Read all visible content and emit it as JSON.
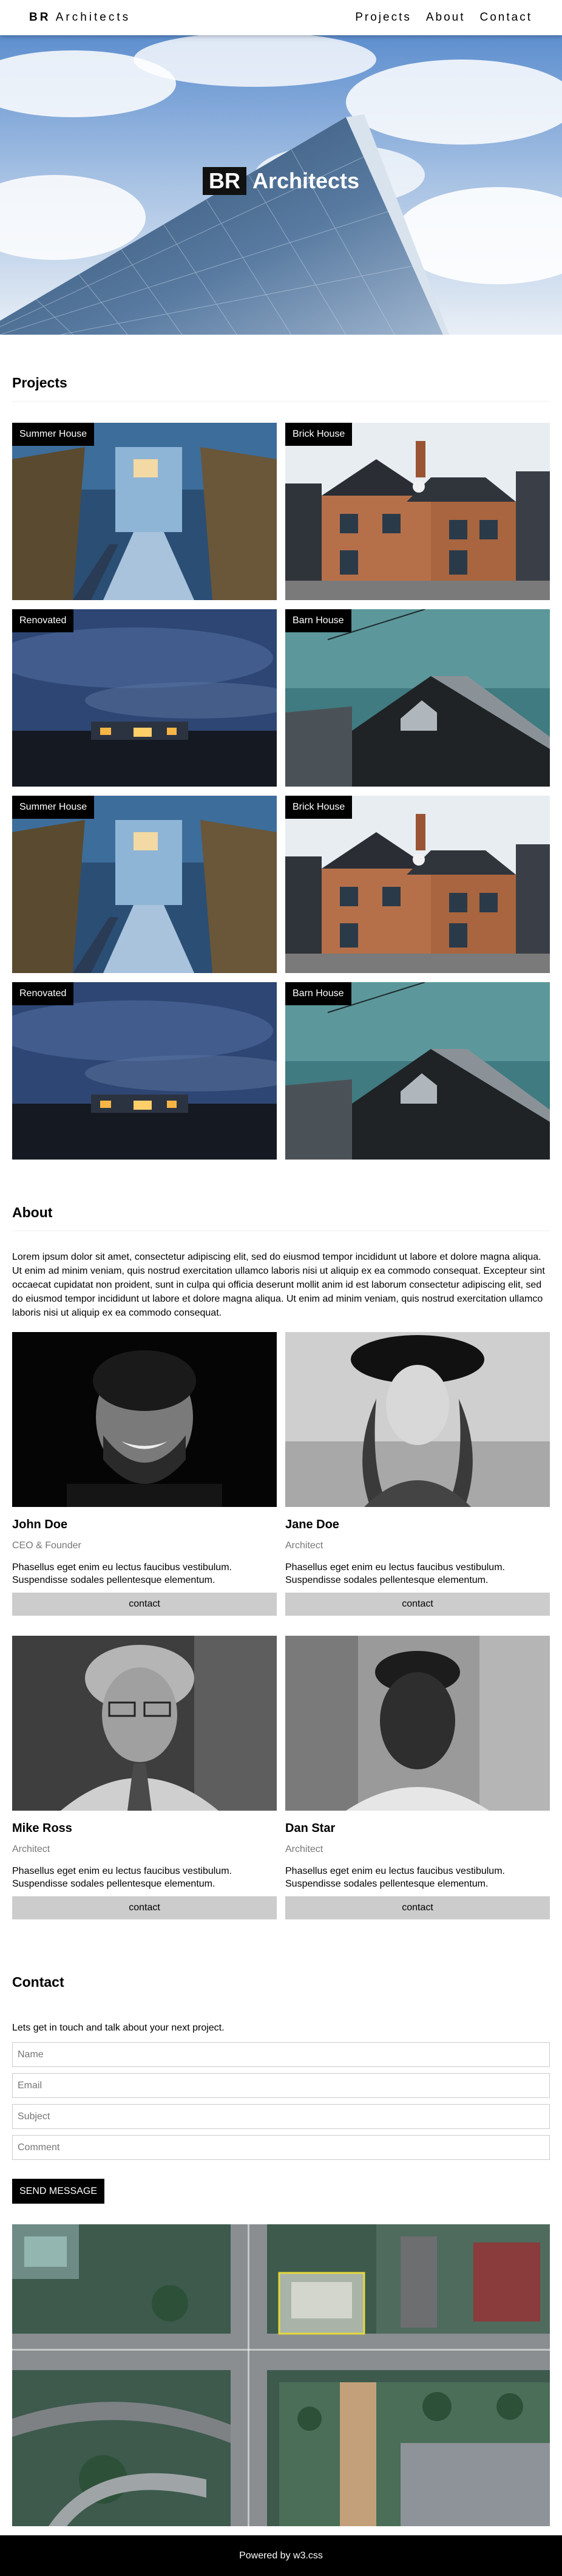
{
  "navbar": {
    "brand_bold": "BR",
    "brand_rest": "Architects",
    "links": [
      "Projects",
      "About",
      "Contact"
    ]
  },
  "hero": {
    "logo_box": "BR",
    "title": "Architects"
  },
  "projects": {
    "heading": "Projects",
    "items": [
      {
        "label": "Summer House"
      },
      {
        "label": "Brick House"
      },
      {
        "label": "Renovated"
      },
      {
        "label": "Barn House"
      },
      {
        "label": "Summer House"
      },
      {
        "label": "Brick House"
      },
      {
        "label": "Renovated"
      },
      {
        "label": "Barn House"
      }
    ]
  },
  "about": {
    "heading": "About",
    "text": "Lorem ipsum dolor sit amet, consectetur adipiscing elit, sed do eiusmod tempor incididunt ut labore et dolore magna aliqua. Ut enim ad minim veniam, quis nostrud exercitation ullamco laboris nisi ut aliquip ex ea commodo consequat. Excepteur sint occaecat cupidatat non proident, sunt in culpa qui officia deserunt mollit anim id est laborum consectetur adipiscing elit, sed do eiusmod tempor incididunt ut labore et dolore magna aliqua. Ut enim ad minim veniam, quis nostrud exercitation ullamco laboris nisi ut aliquip ex ea commodo consequat.",
    "team": [
      {
        "name": "John Doe",
        "role": "CEO & Founder",
        "desc": "Phasellus eget enim eu lectus faucibus vestibulum. Suspendisse sodales pellentesque elementum.",
        "button": "contact"
      },
      {
        "name": "Jane Doe",
        "role": "Architect",
        "desc": "Phasellus eget enim eu lectus faucibus vestibulum. Suspendisse sodales pellentesque elementum.",
        "button": "contact"
      },
      {
        "name": "Mike Ross",
        "role": "Architect",
        "desc": "Phasellus eget enim eu lectus faucibus vestibulum. Suspendisse sodales pellentesque elementum.",
        "button": "contact"
      },
      {
        "name": "Dan Star",
        "role": "Architect",
        "desc": "Phasellus eget enim eu lectus faucibus vestibulum. Suspendisse sodales pellentesque elementum.",
        "button": "contact"
      }
    ]
  },
  "contact": {
    "heading": "Contact",
    "intro": "Lets get in touch and talk about your next project.",
    "fields": {
      "name": {
        "placeholder": "Name",
        "value": ""
      },
      "email": {
        "placeholder": "Email",
        "value": ""
      },
      "subject": {
        "placeholder": "Subject",
        "value": ""
      },
      "comment": {
        "placeholder": "Comment",
        "value": ""
      }
    },
    "send_label": "SEND MESSAGE"
  },
  "footer": {
    "text": "Powered by w3.css"
  },
  "colors": {
    "black": "#000000",
    "white": "#ffffff",
    "button_grey": "#cccccc",
    "muted_text": "#777777"
  }
}
